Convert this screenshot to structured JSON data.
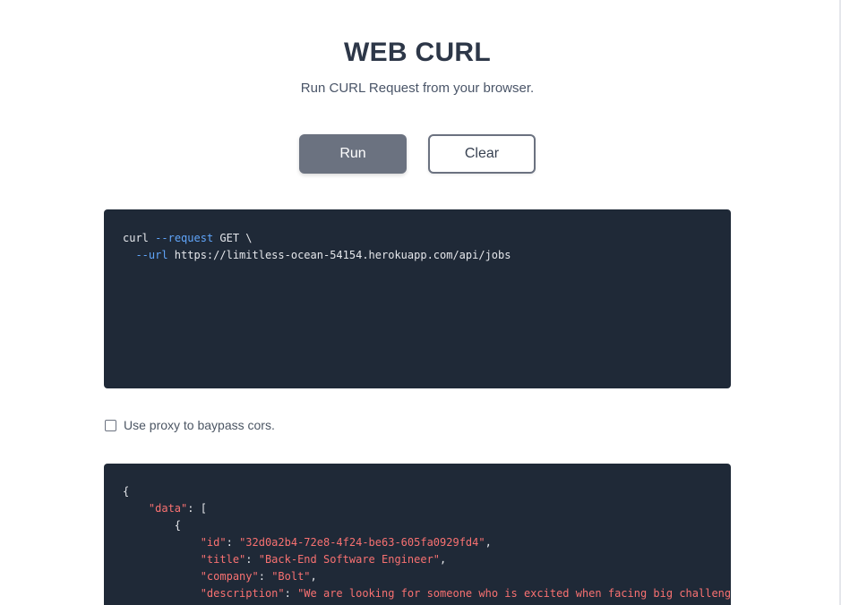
{
  "header": {
    "title": "WEB CURL",
    "subtitle": "Run CURL Request from your browser."
  },
  "buttons": {
    "run_label": "Run",
    "clear_label": "Clear"
  },
  "request": {
    "line1_cmd": "curl",
    "line1_flag": "--request",
    "line1_rest": " GET \\",
    "line2_indent": "  ",
    "line2_flag": "--url",
    "line2_rest": " https://limitless-ocean-54154.herokuapp.com/api/jobs"
  },
  "proxy": {
    "label": "Use proxy to baypass cors.",
    "checked": false
  },
  "response": {
    "open_brace": "{",
    "data_key": "\"data\"",
    "data_sep": ": [",
    "item_open": "{",
    "fields": [
      {
        "key": "\"id\"",
        "value": "\"32d0a2b4-72e8-4f24-be63-605fa0929fd4\""
      },
      {
        "key": "\"title\"",
        "value": "\"Back-End Software Engineer\""
      },
      {
        "key": "\"company\"",
        "value": "\"Bolt\""
      },
      {
        "key": "\"description\"",
        "value": "\"We are looking for someone who is excited when facing big challenges"
      }
    ]
  },
  "colors": {
    "button_run_bg": "#6b7280",
    "code_bg": "#1f2937",
    "flag": "#60a5fa",
    "json_key": "#f87171"
  }
}
